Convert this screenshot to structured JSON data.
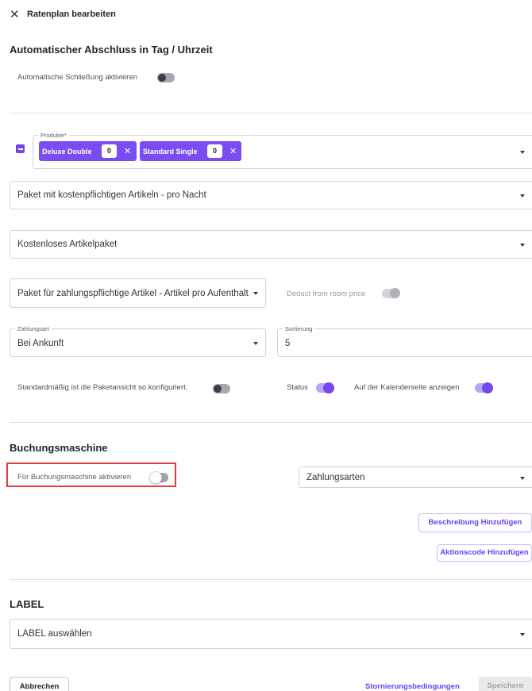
{
  "header": {
    "close_icon": "close-icon",
    "title": "Ratenplan bearbeiten"
  },
  "auto_close": {
    "title": "Automatischer Abschluss in Tag / Uhrzeit",
    "toggle_label": "Automatische Schließung aktivieren",
    "enabled": false
  },
  "products": {
    "label": "Produkte",
    "required_mark": "*",
    "chips": [
      {
        "name": "Deluxe Double",
        "count": "0"
      },
      {
        "name": "Standard Single",
        "count": "0"
      }
    ]
  },
  "paid_package_per_night": {
    "value": "Paket mit kostenpflichtigen Artikeln - pro Nacht"
  },
  "free_package": {
    "value": "Kostenloses Artikelpaket"
  },
  "paid_package_per_stay": {
    "value": "Paket für zahlungspflichtige Artikel - Artikel pro Aufenthalt"
  },
  "deduct_from_room_price": {
    "label": "Deduct from room price",
    "enabled": true,
    "disabled": true
  },
  "payment_type": {
    "label": "Zahlungsart",
    "value": "Bei Ankunft"
  },
  "sorting": {
    "label": "Sortierung",
    "value": "5"
  },
  "default_package_view": {
    "label": "Standardmäßig ist die Paketansicht so konfiguriert.",
    "enabled": false
  },
  "status": {
    "label": "Status",
    "enabled": true
  },
  "show_on_calendar": {
    "label": "Auf der Kalenderseite anzeigen",
    "enabled": true
  },
  "booking_engine": {
    "title": "Buchungsmaschine",
    "toggle_label": "Für Buchungsmaschine aktivieren",
    "enabled": false,
    "payment_methods_placeholder": "Zahlungsarten",
    "add_description_label": "Beschreibung Hinzufügen",
    "add_promo_code_label": "Aktionscode Hinzufügen"
  },
  "label_section": {
    "title": "LABEL",
    "select_placeholder": "LABEL auswählen"
  },
  "footer": {
    "cancel_label": "Abbrechen",
    "cancellation_policy_label": "Stornierungsbedingungen",
    "save_label": "Speichern"
  },
  "colors": {
    "accent": "#7a4cf2",
    "highlight": "#e43c3c"
  }
}
